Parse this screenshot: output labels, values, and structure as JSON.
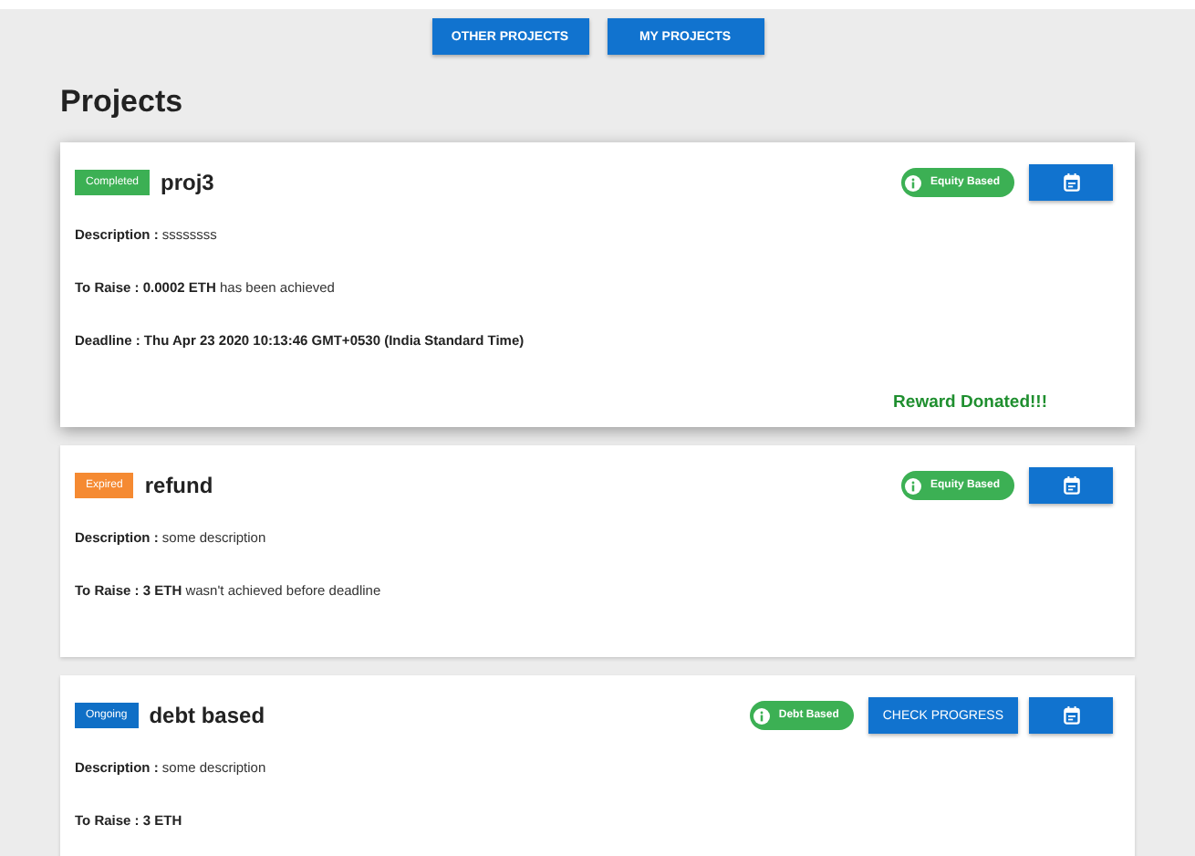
{
  "nav_buttons": [
    {
      "label": "OTHER PROJECTS"
    },
    {
      "label": "MY PROJECTS"
    }
  ],
  "title": "Projects",
  "projects": [
    {
      "status": "Completed",
      "color": "#3cb054",
      "name": "proj3",
      "type": "Equity Based",
      "lines": [
        "**Description :** ssssssss",
        "**To Raise : 0.0002 ETH** has been achieved",
        "**Deadline : Thu Apr 23 2020 10:13:46 GMT+0530 (India Standard Time)**"
      ],
      "footer": "Reward Donated!!!",
      "elevated": true
    },
    {
      "status": "Expired",
      "color": "#f58a32",
      "name": "refund",
      "type": "Equity Based",
      "lines": [
        "**Description :** some description",
        "**To Raise : 3 ETH** wasn't achieved before deadline"
      ],
      "elevated": false
    },
    {
      "status": "Ongoing",
      "color": "#0f6fc6",
      "name": "debt based",
      "type": "Debt Based",
      "check_progress": "CHECK PROGRESS",
      "lines": [
        "**Description :** some description",
        "**To Raise : 3 ETH**"
      ],
      "elevated": false
    }
  ]
}
